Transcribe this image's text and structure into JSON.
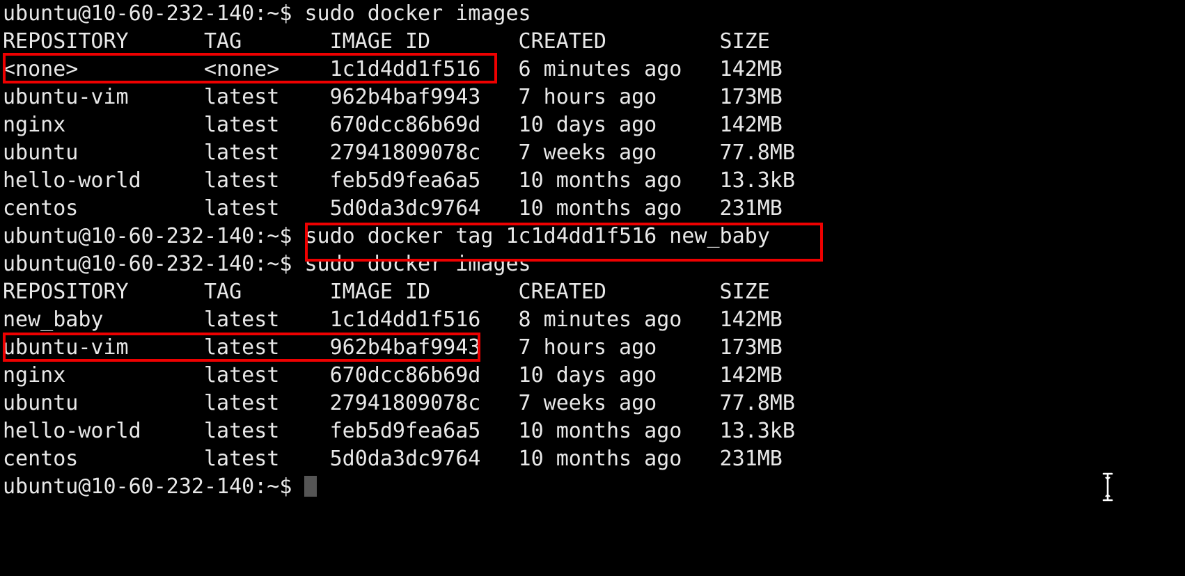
{
  "terminal": {
    "prompt": "ubuntu@10-60-232-140:~$",
    "cursor_glyph": "block-cursor",
    "mouse_cursor": "i-beam-text-cursor",
    "colors": {
      "background": "#000000",
      "foreground": "#e8e8e8",
      "highlight_box": "#ee0000",
      "block_cursor": "#555555"
    }
  },
  "commands": {
    "images_1": "sudo docker images",
    "tag": "sudo docker tag 1c1d4dd1f516 new_baby",
    "images_2": "sudo docker images"
  },
  "table_header": {
    "repository": "REPOSITORY",
    "tag": "TAG",
    "image_id": "IMAGE ID",
    "created": "CREATED",
    "size": "SIZE"
  },
  "lines": {
    "l01": "ubuntu@10-60-232-140:~$ sudo docker images",
    "l02": "REPOSITORY      TAG       IMAGE ID       CREATED         SIZE",
    "l03": "<none>          <none>    1c1d4dd1f516   6 minutes ago   142MB",
    "l04": "ubuntu-vim      latest    962b4baf9943   7 hours ago     173MB",
    "l05": "nginx           latest    670dcc86b69d   10 days ago     142MB",
    "l06": "ubuntu          latest    27941809078c   7 weeks ago     77.8MB",
    "l07": "hello-world     latest    feb5d9fea6a5   10 months ago   13.3kB",
    "l08": "centos          latest    5d0da3dc9764   10 months ago   231MB",
    "l09": "ubuntu@10-60-232-140:~$ sudo docker tag 1c1d4dd1f516 new_baby",
    "l10": "ubuntu@10-60-232-140:~$ sudo docker images",
    "l11": "REPOSITORY      TAG       IMAGE ID       CREATED         SIZE",
    "l12": "new_baby        latest    1c1d4dd1f516   8 minutes ago   142MB",
    "l13": "ubuntu-vim      latest    962b4baf9943   7 hours ago     173MB",
    "l14": "nginx           latest    670dcc86b69d   10 days ago     142MB",
    "l15": "ubuntu          latest    27941809078c   7 weeks ago     77.8MB",
    "l16": "hello-world     latest    feb5d9fea6a5   10 months ago   13.3kB",
    "l17": "centos          latest    5d0da3dc9764   10 months ago   231MB",
    "l18": "ubuntu@10-60-232-140:~$ "
  },
  "images_first_listing": {
    "columns": [
      "REPOSITORY",
      "TAG",
      "IMAGE ID",
      "CREATED",
      "SIZE"
    ],
    "rows": [
      {
        "repository": "<none>",
        "tag": "<none>",
        "image_id": "1c1d4dd1f516",
        "created": "6 minutes ago",
        "size": "142MB",
        "highlighted": true
      },
      {
        "repository": "ubuntu-vim",
        "tag": "latest",
        "image_id": "962b4baf9943",
        "created": "7 hours ago",
        "size": "173MB",
        "highlighted": false
      },
      {
        "repository": "nginx",
        "tag": "latest",
        "image_id": "670dcc86b69d",
        "created": "10 days ago",
        "size": "142MB",
        "highlighted": false
      },
      {
        "repository": "ubuntu",
        "tag": "latest",
        "image_id": "27941809078c",
        "created": "7 weeks ago",
        "size": "77.8MB",
        "highlighted": false
      },
      {
        "repository": "hello-world",
        "tag": "latest",
        "image_id": "feb5d9fea6a5",
        "created": "10 months ago",
        "size": "13.3kB",
        "highlighted": false
      },
      {
        "repository": "centos",
        "tag": "latest",
        "image_id": "5d0da3dc9764",
        "created": "10 months ago",
        "size": "231MB",
        "highlighted": false
      }
    ]
  },
  "images_second_listing": {
    "columns": [
      "REPOSITORY",
      "TAG",
      "IMAGE ID",
      "CREATED",
      "SIZE"
    ],
    "rows": [
      {
        "repository": "new_baby",
        "tag": "latest",
        "image_id": "1c1d4dd1f516",
        "created": "8 minutes ago",
        "size": "142MB",
        "highlighted": true
      },
      {
        "repository": "ubuntu-vim",
        "tag": "latest",
        "image_id": "962b4baf9943",
        "created": "7 hours ago",
        "size": "173MB",
        "highlighted": false
      },
      {
        "repository": "nginx",
        "tag": "latest",
        "image_id": "670dcc86b69d",
        "created": "10 days ago",
        "size": "142MB",
        "highlighted": false
      },
      {
        "repository": "ubuntu",
        "tag": "latest",
        "image_id": "27941809078c",
        "created": "7 weeks ago",
        "size": "77.8MB",
        "highlighted": false
      },
      {
        "repository": "hello-world",
        "tag": "latest",
        "image_id": "feb5d9fea6a5",
        "created": "10 months ago",
        "size": "13.3kB",
        "highlighted": false
      },
      {
        "repository": "centos",
        "tag": "latest",
        "image_id": "5d0da3dc9764",
        "created": "10 months ago",
        "size": "231MB",
        "highlighted": false
      }
    ]
  },
  "annotations": [
    {
      "name": "highlight-none-image-row",
      "target": "<none> <none> 1c1d4dd1f516"
    },
    {
      "name": "highlight-docker-tag-command",
      "target": "sudo docker tag 1c1d4dd1f516 new_baby"
    },
    {
      "name": "highlight-new-baby-image-row",
      "target": "new_baby latest 1c1d4dd1f516"
    }
  ]
}
